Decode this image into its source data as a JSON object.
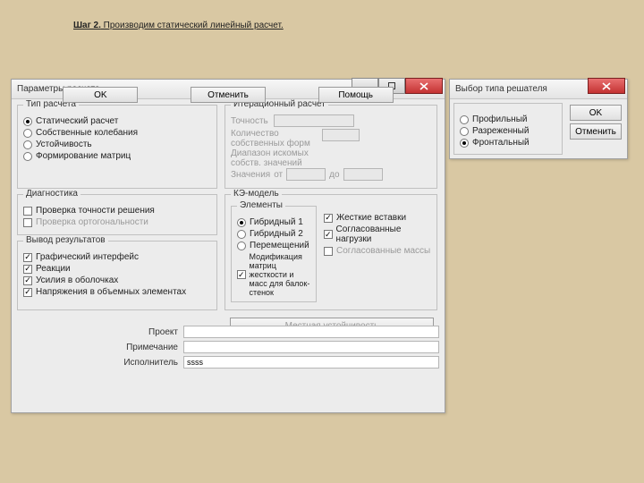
{
  "header": {
    "step": "Шаг 2.",
    "rest": " Производим статический линейный расчет."
  },
  "main": {
    "title": "Параметры расчета",
    "groups": {
      "calc_type": {
        "title": "Тип расчета",
        "options": [
          "Статический расчет",
          "Собственные колебания",
          "Устойчивость",
          "Формирование матриц"
        ]
      },
      "iter": {
        "title": "Итерационный расчет",
        "precision": "Точность",
        "count": "Количество собственных форм",
        "range": "Диапазон искомых собств. значений",
        "values": "Значения",
        "from": "от",
        "to": "до"
      },
      "diag": {
        "title": "Диагностика",
        "options": [
          "Проверка точности решения",
          "Проверка ортогональности"
        ]
      },
      "output": {
        "title": "Вывод результатов",
        "options": [
          "Графический интерфейс",
          "Реакции",
          "Усилия в оболочках",
          "Напряжения в объемных элементах"
        ]
      },
      "kemodel": {
        "title": "КЭ-модель",
        "elem_title": "Элементы",
        "elem_options": [
          "Гибридный 1",
          "Гибридный 2",
          "Перемещений"
        ],
        "mod": "Модификация матриц жесткости и масс для балок-стенок",
        "right": [
          "Жесткие вставки",
          "Согласованные нагрузки",
          "Согласованные массы"
        ],
        "local": "Местная устойчивость"
      }
    },
    "rows": {
      "project": "Проект",
      "note": "Примечание",
      "exec": "Исполнитель",
      "exec_val": "ssss"
    },
    "buttons": {
      "ok": "OK",
      "cancel": "Отменить",
      "help": "Помощь"
    }
  },
  "solver": {
    "title": "Выбор типа решателя",
    "options": [
      "Профильный",
      "Разреженный",
      "Фронтальный"
    ],
    "ok": "OK",
    "cancel": "Отменить"
  }
}
